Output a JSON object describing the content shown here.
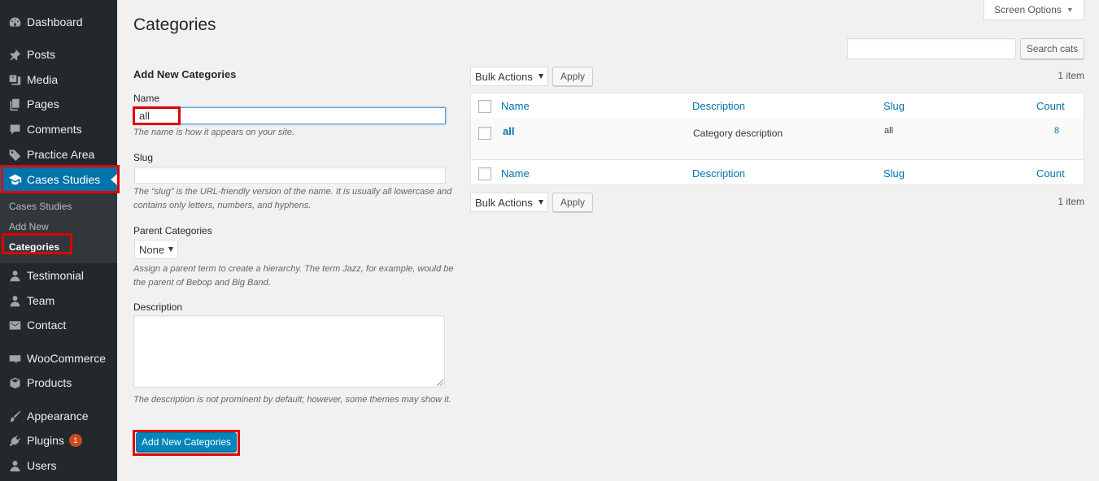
{
  "sidebar": {
    "items": [
      {
        "label": "Dashboard",
        "icon": "dashboard-icon"
      },
      {
        "label": "Posts",
        "icon": "pin-icon"
      },
      {
        "label": "Media",
        "icon": "media-icon"
      },
      {
        "label": "Pages",
        "icon": "pages-icon"
      },
      {
        "label": "Comments",
        "icon": "comments-icon"
      },
      {
        "label": "Practice Area",
        "icon": "tag-icon"
      },
      {
        "label": "Cases Studies",
        "icon": "graduation-cap-icon"
      },
      {
        "label": "Testimonial",
        "icon": "user-icon"
      },
      {
        "label": "Team",
        "icon": "user-icon"
      },
      {
        "label": "Contact",
        "icon": "email-icon"
      },
      {
        "label": "WooCommerce",
        "icon": "woocommerce-icon"
      },
      {
        "label": "Products",
        "icon": "box-icon"
      },
      {
        "label": "Appearance",
        "icon": "brush-icon"
      },
      {
        "label": "Plugins",
        "icon": "plugin-icon"
      },
      {
        "label": "Users",
        "icon": "user-icon"
      }
    ],
    "submenu": [
      "Cases Studies",
      "Add New",
      "Categories"
    ],
    "plugins_badge": "1"
  },
  "page": {
    "title": "Categories",
    "screen_options": "Screen Options",
    "search_button": "Search cats",
    "search_value": ""
  },
  "form": {
    "heading": "Add New Categories",
    "name_label": "Name",
    "name_value": "all",
    "name_help": "The name is how it appears on your site.",
    "slug_label": "Slug",
    "slug_value": "",
    "slug_help": "The “slug” is the URL-friendly version of the name. It is usually all lowercase and contains only letters, numbers, and hyphens.",
    "parent_label": "Parent Categories",
    "parent_value": "None",
    "parent_help": "Assign a parent term to create a hierarchy. The term Jazz, for example, would be the parent of Bebop and Big Band.",
    "description_label": "Description",
    "description_help": "The description is not prominent by default; however, some themes may show it.",
    "submit_label": "Add New Categories"
  },
  "table": {
    "bulk_actions": "Bulk Actions",
    "apply": "Apply",
    "items_count": "1 item",
    "columns": [
      "Name",
      "Description",
      "Slug",
      "Count"
    ],
    "rows": [
      {
        "name": "all",
        "description": "Category description",
        "slug": "all",
        "count": "8"
      }
    ]
  },
  "colors": {
    "sidebar_bg": "#23282d",
    "accent": "#0073aa",
    "highlight_box": "#e00000",
    "badge": "#ca4a1f"
  }
}
